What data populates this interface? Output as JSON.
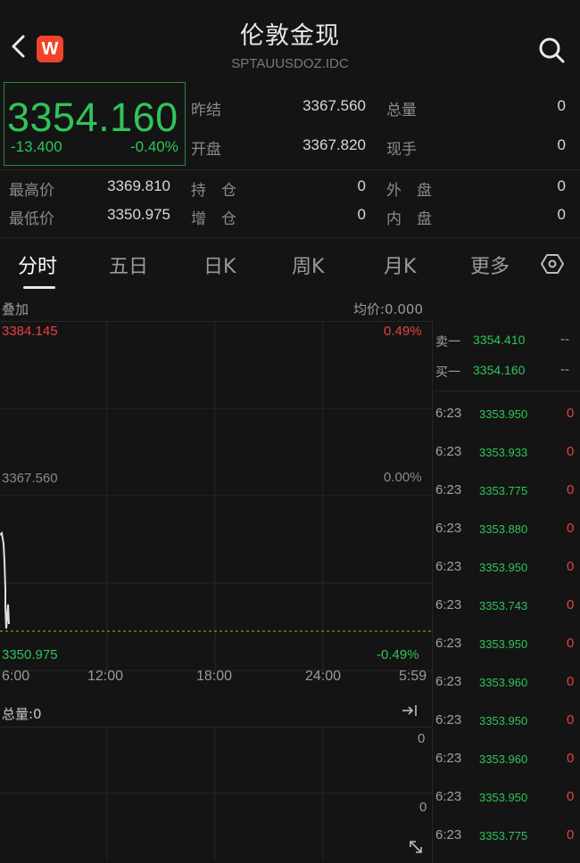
{
  "header": {
    "title": "伦敦金现",
    "code": "SPTAUUSDOZ.IDC",
    "logo_text": "W"
  },
  "quote": {
    "price": "3354.160",
    "change": "-13.400",
    "change_pct": "-0.40%",
    "fields": [
      {
        "label": "昨结",
        "value": "3367.560"
      },
      {
        "label": "总量",
        "value": "0"
      },
      {
        "label": "开盘",
        "value": "3367.820"
      },
      {
        "label": "现手",
        "value": "0"
      },
      {
        "label": "最高价",
        "value": "3369.810"
      },
      {
        "label": "持　仓",
        "value": "0"
      },
      {
        "label": "外　盘",
        "value": "0"
      },
      {
        "label": "最低价",
        "value": "3350.975"
      },
      {
        "label": "增　仓",
        "value": "0"
      },
      {
        "label": "内　盘",
        "value": "0"
      }
    ]
  },
  "tabs": [
    "分时",
    "五日",
    "日K",
    "周K",
    "月K",
    "更多"
  ],
  "chart": {
    "overlay_label": "叠加",
    "avg_label": "均价:0.000",
    "y_high": "3384.145",
    "y_mid": "3367.560",
    "y_low": "3350.975",
    "pct_high": "0.49%",
    "pct_mid": "0.00%",
    "pct_low": "-0.49%",
    "x_labels": [
      "6:00",
      "12:00",
      "18:00",
      "24:00",
      "5:59"
    ],
    "volume_label": "总量:0",
    "vol_top": "0",
    "vol_bottom": "0"
  },
  "chart_data": {
    "type": "line",
    "ylim": [
      3350.975,
      3384.145
    ],
    "x": [
      "6:00",
      "6:23"
    ],
    "series": [
      {
        "values": [
          3367.82,
          3354.16
        ]
      }
    ]
  },
  "book": {
    "sell_label": "卖一",
    "sell_price": "3354.410",
    "sell_vol": "--",
    "buy_label": "买一",
    "buy_price": "3354.160",
    "buy_vol": "--"
  },
  "ticks": [
    {
      "time": "6:23",
      "price": "3353.950",
      "vol": "0"
    },
    {
      "time": "6:23",
      "price": "3353.933",
      "vol": "0"
    },
    {
      "time": "6:23",
      "price": "3353.775",
      "vol": "0"
    },
    {
      "time": "6:23",
      "price": "3353.880",
      "vol": "0"
    },
    {
      "time": "6:23",
      "price": "3353.950",
      "vol": "0"
    },
    {
      "time": "6:23",
      "price": "3353.743",
      "vol": "0"
    },
    {
      "time": "6:23",
      "price": "3353.950",
      "vol": "0"
    },
    {
      "time": "6:23",
      "price": "3353.960",
      "vol": "0"
    },
    {
      "time": "6:23",
      "price": "3353.950",
      "vol": "0"
    },
    {
      "time": "6:23",
      "price": "3353.960",
      "vol": "0"
    },
    {
      "time": "6:23",
      "price": "3353.950",
      "vol": "0"
    },
    {
      "time": "6:23",
      "price": "3353.775",
      "vol": "0"
    }
  ]
}
